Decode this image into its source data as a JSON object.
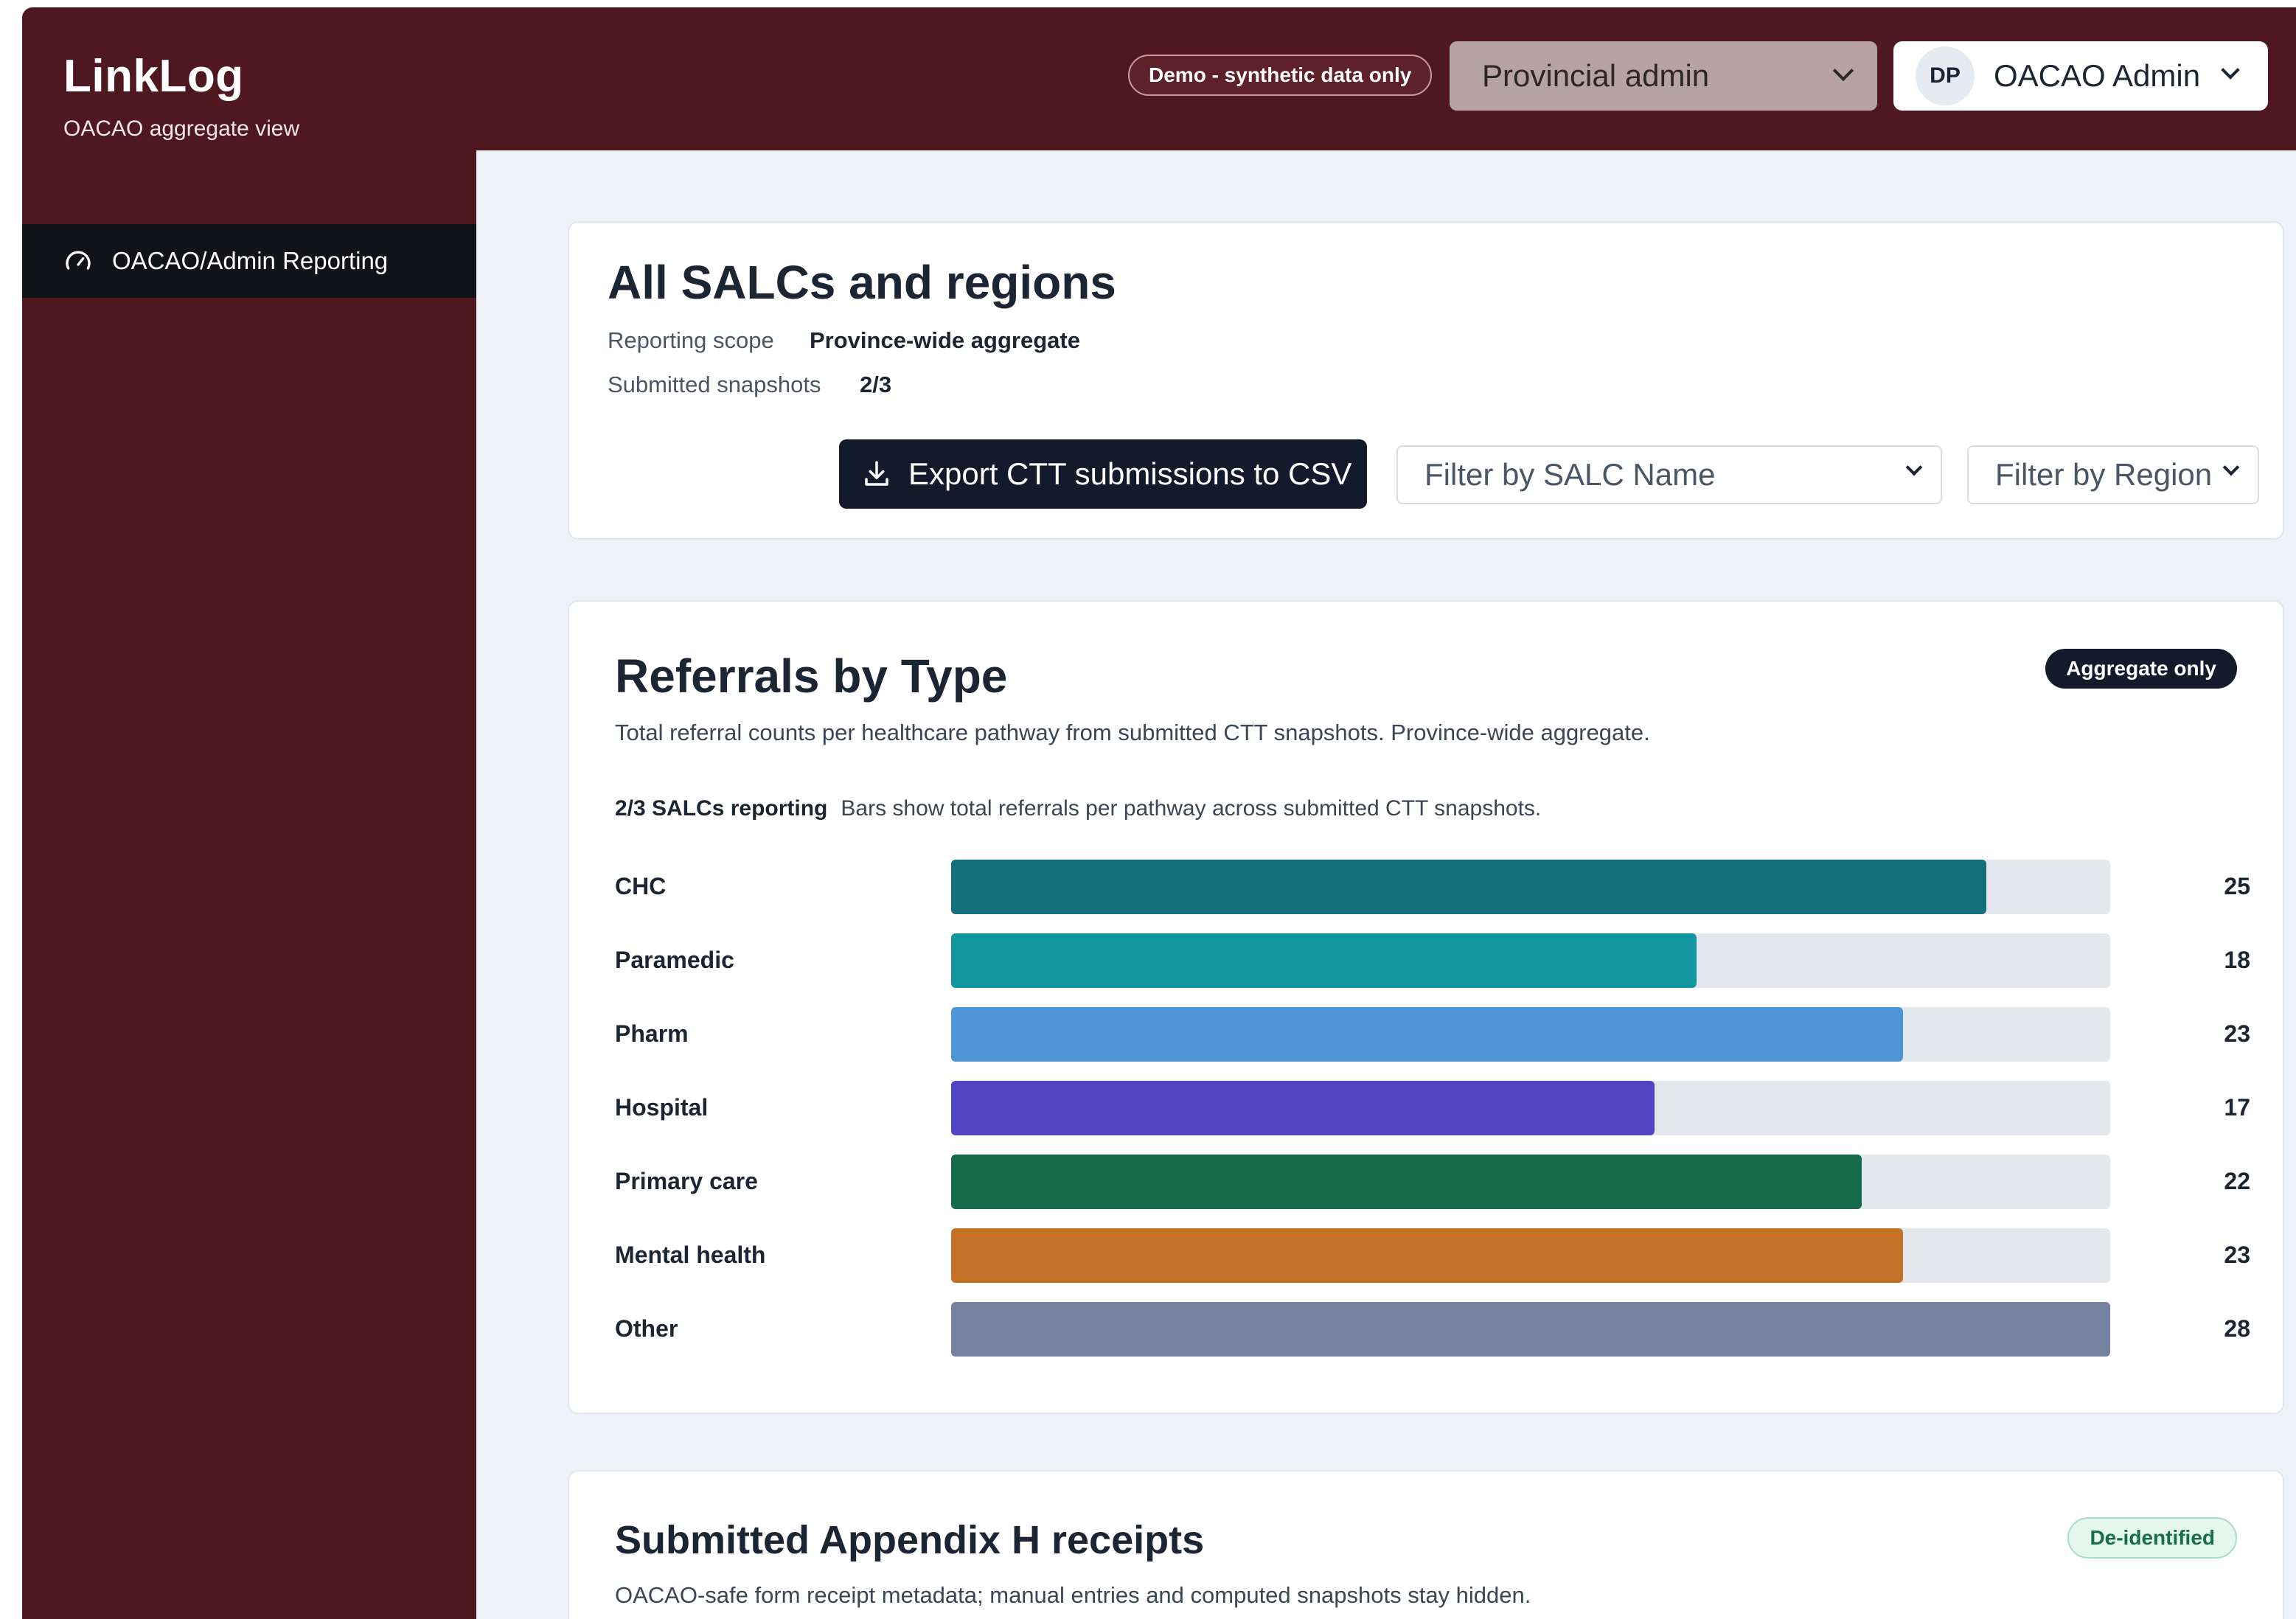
{
  "brand": {
    "title": "LinkLog",
    "subtitle": "OACAO aggregate view"
  },
  "header": {
    "demo_badge": "Demo - synthetic data only",
    "role_select": "Provincial admin",
    "user": {
      "initials": "DP",
      "name": "OACAO Admin"
    }
  },
  "sidebar": {
    "items": [
      {
        "label": "OACAO/Admin Reporting",
        "icon": "gauge-icon",
        "active": true
      }
    ]
  },
  "scope": {
    "title": "All SALCs and regions",
    "reporting_scope_label": "Reporting scope",
    "reporting_scope_value": "Province-wide aggregate",
    "submitted_label": "Submitted snapshots",
    "submitted_value": "2/3",
    "export_label": "Export CTT submissions to CSV",
    "filter_salc": "Filter by SALC Name",
    "filter_region": "Filter by Region"
  },
  "referrals": {
    "title": "Referrals by Type",
    "badge": "Aggregate only",
    "description": "Total referral counts per healthcare pathway from submitted CTT snapshots. Province-wide aggregate.",
    "note_bold": "2/3 SALCs reporting",
    "note_text": "Bars show total referrals per pathway across submitted CTT snapshots."
  },
  "chart_data": {
    "type": "bar",
    "orientation": "horizontal",
    "categories": [
      "CHC",
      "Paramedic",
      "Pharm",
      "Hospital",
      "Primary care",
      "Mental health",
      "Other"
    ],
    "values": [
      25,
      18,
      23,
      17,
      22,
      23,
      28
    ],
    "colors": [
      "#136f79",
      "#13979f",
      "#4e95d6",
      "#5145c4",
      "#176b4d",
      "#c37126",
      "#74819f"
    ],
    "xlim": [
      0,
      28
    ],
    "grid": false,
    "legend": "none"
  },
  "receipts": {
    "title": "Submitted Appendix H receipts",
    "badge": "De-identified",
    "description": "OACAO-safe form receipt metadata; manual entries and computed snapshots stay hidden."
  }
}
